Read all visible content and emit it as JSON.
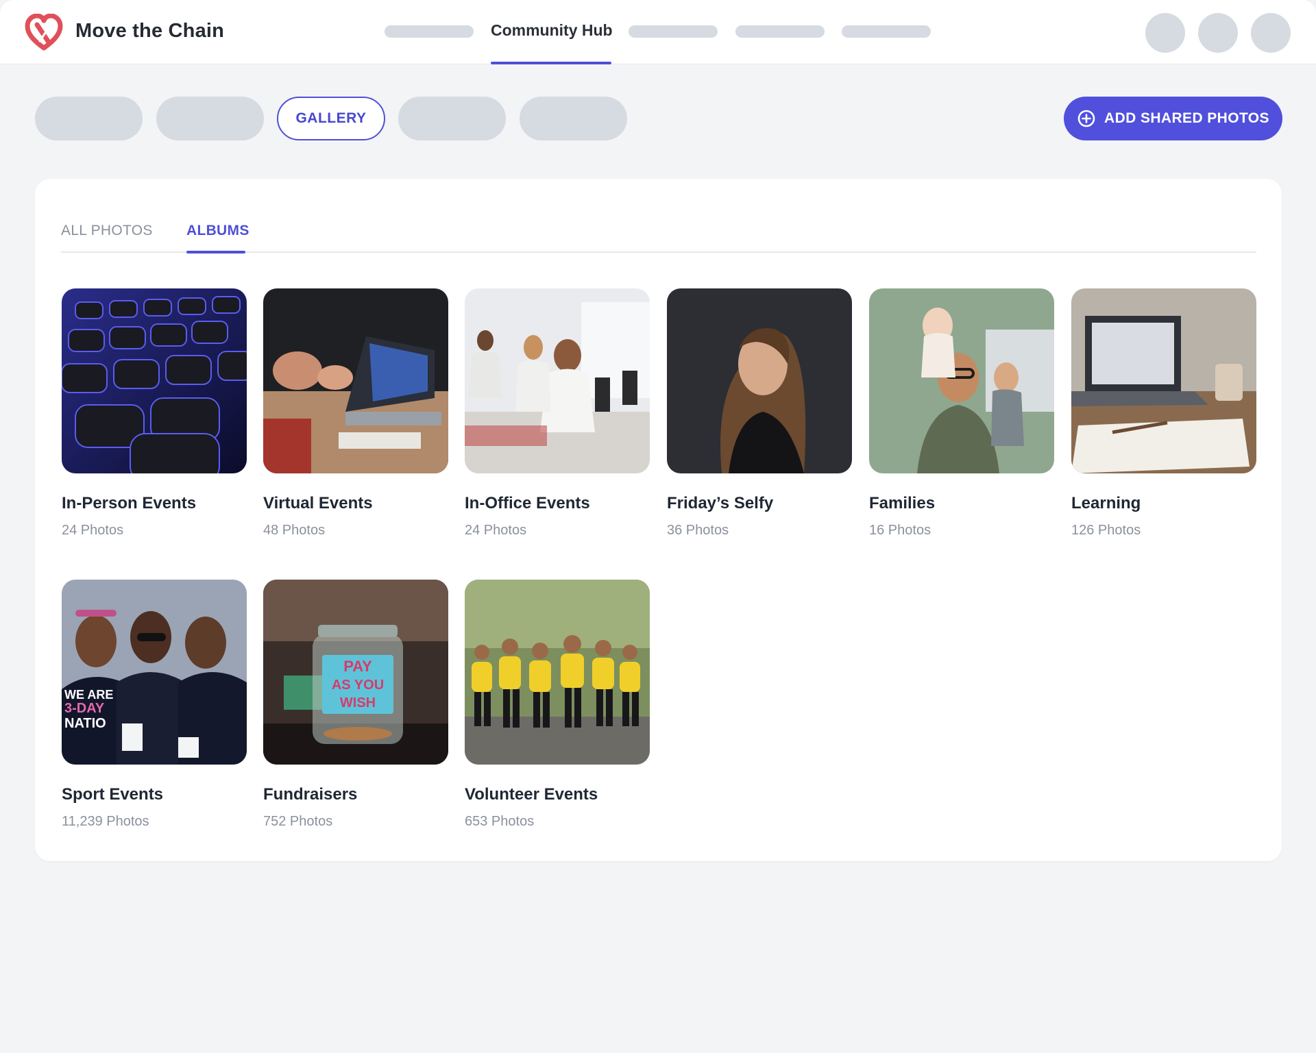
{
  "brand": {
    "name": "Move the Chain",
    "logo_icon": "heart-chain-logo-icon",
    "logo_color": "#e0505a"
  },
  "nav": {
    "active_label": "Community Hub"
  },
  "accent": "#4f4fd8",
  "sections": {
    "active_label": "GALLERY"
  },
  "actions": {
    "add_label": "ADD SHARED PHOTOS",
    "add_icon": "plus-circle-icon"
  },
  "tabs": [
    {
      "label": "ALL PHOTOS",
      "active": false
    },
    {
      "label": "ALBUMS",
      "active": true
    }
  ],
  "albums": [
    {
      "title": "In-Person Events",
      "count": "24 Photos"
    },
    {
      "title": "Virtual Events",
      "count": "48 Photos"
    },
    {
      "title": "In-Office Events",
      "count": "24 Photos"
    },
    {
      "title": "Friday’s Selfy",
      "count": "36 Photos"
    },
    {
      "title": "Families",
      "count": "16 Photos"
    },
    {
      "title": "Learning",
      "count": "126 Photos"
    },
    {
      "title": "Sport Events",
      "count": "11,239 Photos"
    },
    {
      "title": "Fundraisers",
      "count": "752 Photos"
    },
    {
      "title": "Volunteer Events",
      "count": "653 Photos"
    }
  ],
  "album_images": {
    "jar_text_1": "PAY",
    "jar_text_2": "AS YOU",
    "jar_text_3": "WISH",
    "shirt_text_1": "WE ARE",
    "shirt_text_2": "3-DAY",
    "shirt_text_3": "NATIO"
  }
}
